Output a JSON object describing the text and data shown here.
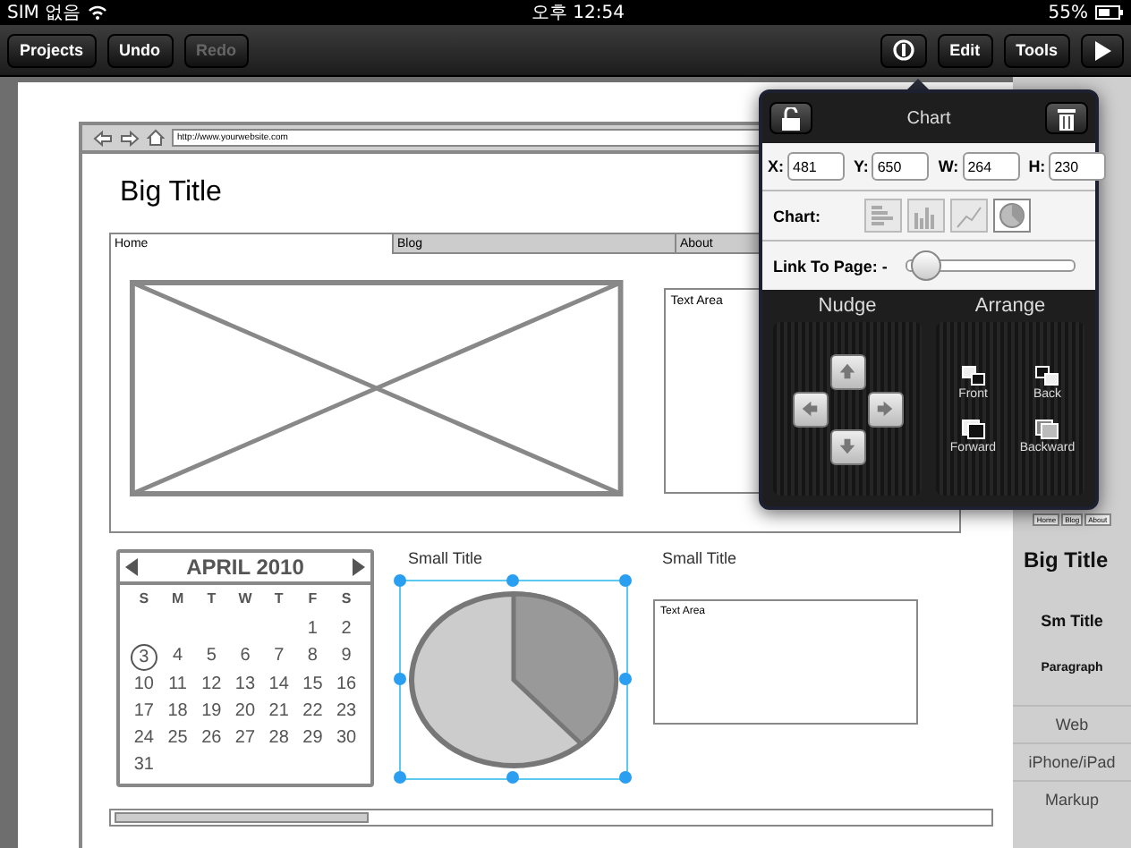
{
  "status_bar": {
    "carrier": "SIM 없음",
    "time": "오후 12:54",
    "battery": "55%"
  },
  "toolbar": {
    "left_buttons": [
      {
        "label": "Projects",
        "disabled": false
      },
      {
        "label": "Undo",
        "disabled": false
      },
      {
        "label": "Redo",
        "disabled": true
      }
    ],
    "right_buttons": [
      {
        "kind": "info"
      },
      {
        "kind": "text",
        "label": "Edit"
      },
      {
        "kind": "text",
        "label": "Tools"
      },
      {
        "kind": "play"
      }
    ]
  },
  "mockup": {
    "url": "http://www.yourwebsite.com",
    "big_title": "Big Title",
    "tabs": [
      {
        "label": "Home",
        "selected": true
      },
      {
        "label": "Blog",
        "selected": false
      },
      {
        "label": "About",
        "selected": false
      }
    ],
    "text_area": "Text Area",
    "calendar": {
      "month": "APRIL 2010",
      "weekdays": [
        "S",
        "M",
        "T",
        "W",
        "T",
        "F",
        "S"
      ],
      "weeks": [
        [
          {
            "day": "1",
            "selected": false
          },
          {
            "day": "2",
            "selected": false
          }
        ],
        [
          {
            "day": "3",
            "selected": true
          },
          {
            "day": "4",
            "selected": false
          },
          {
            "day": "5",
            "selected": false
          },
          {
            "day": "6",
            "selected": false
          },
          {
            "day": "7",
            "selected": false
          },
          {
            "day": "8",
            "selected": false
          },
          {
            "day": "9",
            "selected": false
          }
        ],
        [
          {
            "day": "10",
            "selected": false
          },
          {
            "day": "11",
            "selected": false
          },
          {
            "day": "12",
            "selected": false
          },
          {
            "day": "13",
            "selected": false
          },
          {
            "day": "14",
            "selected": false
          },
          {
            "day": "15",
            "selected": false
          },
          {
            "day": "16",
            "selected": false
          }
        ],
        [
          {
            "day": "17",
            "selected": false
          },
          {
            "day": "18",
            "selected": false
          },
          {
            "day": "19",
            "selected": false
          },
          {
            "day": "20",
            "selected": false
          },
          {
            "day": "21",
            "selected": false
          },
          {
            "day": "22",
            "selected": false
          },
          {
            "day": "23",
            "selected": false
          }
        ],
        [
          {
            "day": "24",
            "selected": false
          },
          {
            "day": "25",
            "selected": false
          },
          {
            "day": "26",
            "selected": false
          },
          {
            "day": "27",
            "selected": false
          },
          {
            "day": "28",
            "selected": false
          },
          {
            "day": "29",
            "selected": false
          },
          {
            "day": "30",
            "selected": false
          }
        ],
        [
          {
            "day": "31",
            "selected": false
          }
        ]
      ]
    },
    "chart_widget": {
      "title": "Small Title",
      "selected": true
    },
    "text_widget": {
      "title": "Small Title",
      "text": "Text Area"
    }
  },
  "palette": {
    "tabs_preview": [
      "Home",
      "Blog",
      "About"
    ],
    "items": [
      {
        "label": "Big Title",
        "kind": "big"
      },
      {
        "label": "Sm Title",
        "kind": "small"
      },
      {
        "label": "Paragraph",
        "kind": "paragraph"
      }
    ],
    "categories": [
      "Web",
      "iPhone/iPad",
      "Markup"
    ]
  },
  "popover": {
    "title": "Chart",
    "fields": [
      {
        "label": "X:",
        "value": "481"
      },
      {
        "label": "Y:",
        "value": "650"
      },
      {
        "label": "W:",
        "value": "264"
      },
      {
        "label": "H:",
        "value": "230"
      }
    ],
    "chart_label": "Chart:",
    "chart_types": [
      {
        "kind": "hbar",
        "selected": false
      },
      {
        "kind": "bar",
        "selected": false
      },
      {
        "kind": "line",
        "selected": false
      },
      {
        "kind": "pie",
        "selected": true
      }
    ],
    "link": {
      "label": "Link To Page: -",
      "level": 0.03
    },
    "nudge": {
      "title": "Nudge",
      "buttons": [
        {
          "kind": "up"
        },
        {
          "kind": "left"
        },
        {
          "kind": "right"
        },
        {
          "kind": "down"
        }
      ]
    },
    "arrange": {
      "title": "Arrange",
      "buttons": [
        {
          "kind": "front",
          "label": "Front"
        },
        {
          "kind": "back",
          "label": "Back"
        },
        {
          "kind": "forward",
          "label": "Forward"
        },
        {
          "kind": "backward",
          "label": "Backward"
        }
      ]
    }
  }
}
